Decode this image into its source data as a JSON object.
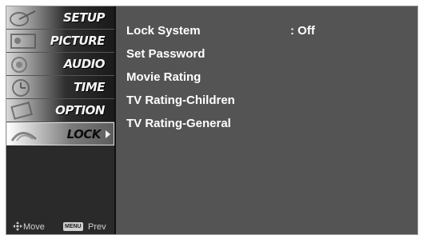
{
  "sidebar": {
    "items": [
      {
        "label": "SETUP",
        "icon": "satellite-dish-icon",
        "active": false
      },
      {
        "label": "PICTURE",
        "icon": "film-reel-icon",
        "active": false
      },
      {
        "label": "AUDIO",
        "icon": "speaker-icon",
        "active": false
      },
      {
        "label": "TIME",
        "icon": "clock-icon",
        "active": false
      },
      {
        "label": "OPTION",
        "icon": "option-icon",
        "active": false
      },
      {
        "label": "LOCK",
        "icon": "lock-icon",
        "active": true
      }
    ]
  },
  "footer": {
    "move_label": "Move",
    "menu_key": "MENU",
    "prev_label": "Prev"
  },
  "lock_menu": {
    "items": [
      {
        "label": "Lock System",
        "value": ": Off"
      },
      {
        "label": "Set Password",
        "value": ""
      },
      {
        "label": "Movie Rating",
        "value": ""
      },
      {
        "label": "TV Rating-Children",
        "value": ""
      },
      {
        "label": "TV Rating-General",
        "value": ""
      }
    ]
  },
  "colors": {
    "panel_background": "#545454",
    "sidebar_background": "#2a2a2a",
    "text": "#ffffff",
    "active_item": "#ffffff"
  }
}
